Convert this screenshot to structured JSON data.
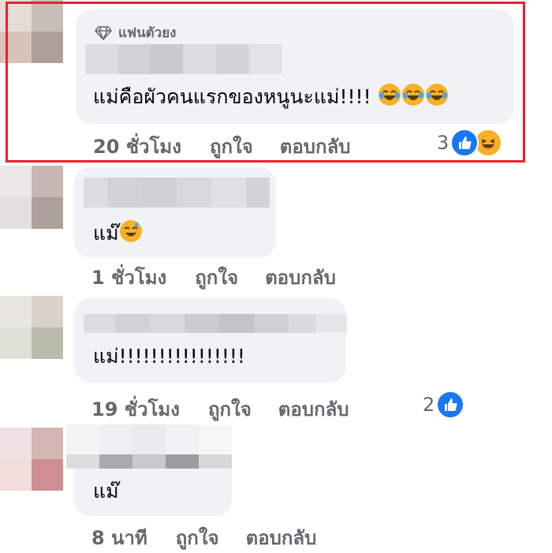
{
  "comments": [
    {
      "badge": "แฟนตัวยง",
      "text": "แม่คือผัวคนแรกของหนูนะแม่!!!!",
      "time": "20 ชั่วโมง",
      "like_label": "ถูกใจ",
      "reply_label": "ตอบกลับ",
      "reaction_count": "3",
      "reactions": [
        "like-icon",
        "haha-icon"
      ],
      "emoji": [
        "rofl-emoji",
        "rofl-emoji",
        "rofl-emoji"
      ],
      "highlighted": true
    },
    {
      "text": "แม๊",
      "time": "1 ชั่วโมง",
      "like_label": "ถูกใจ",
      "reply_label": "ตอบกลับ",
      "emoji": [
        "sweat-smile-emoji"
      ]
    },
    {
      "text": "แม่!!!!!!!!!!!!!!!!",
      "time": "19 ชั่วโมง",
      "like_label": "ถูกใจ",
      "reply_label": "ตอบกลับ",
      "reaction_count": "2",
      "reactions": [
        "like-icon"
      ]
    },
    {
      "text": "แม๊",
      "time": "8 นาที",
      "like_label": "ถูกใจ",
      "reply_label": "ตอบกลับ"
    }
  ],
  "colors": {
    "highlight": "#e8212e",
    "bubble": "#f0f2f5",
    "meta_text": "#65676b",
    "like_blue": "#1877f2",
    "haha_yellow": "#f7b125"
  }
}
